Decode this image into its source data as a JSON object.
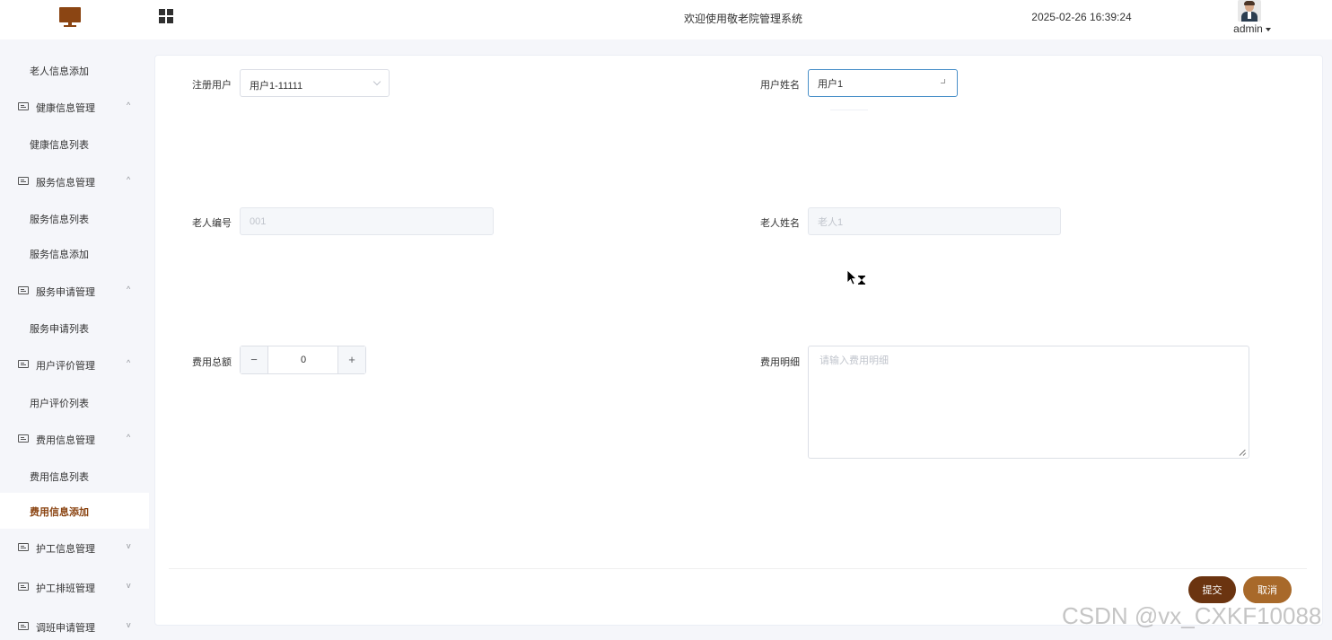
{
  "header": {
    "welcome": "欢迎使用敬老院管理系统",
    "datetime": "2025-02-26 16:39:24",
    "user": "admin"
  },
  "sidebar": {
    "items": [
      {
        "label": "老人信息添加",
        "type": "sub"
      },
      {
        "label": "健康信息管理",
        "type": "group",
        "chevron": "^"
      },
      {
        "label": "健康信息列表",
        "type": "sub"
      },
      {
        "label": "服务信息管理",
        "type": "group",
        "chevron": "^"
      },
      {
        "label": "服务信息列表",
        "type": "sub"
      },
      {
        "label": "服务信息添加",
        "type": "sub"
      },
      {
        "label": "服务申请管理",
        "type": "group",
        "chevron": "^"
      },
      {
        "label": "服务申请列表",
        "type": "sub"
      },
      {
        "label": "用户评价管理",
        "type": "group",
        "chevron": "^"
      },
      {
        "label": "用户评价列表",
        "type": "sub"
      },
      {
        "label": "费用信息管理",
        "type": "group",
        "chevron": "^"
      },
      {
        "label": "费用信息列表",
        "type": "sub"
      },
      {
        "label": "费用信息添加",
        "type": "sub",
        "active": true
      },
      {
        "label": "护工信息管理",
        "type": "group",
        "chevron": "v"
      },
      {
        "label": "护工排班管理",
        "type": "group",
        "chevron": "v"
      },
      {
        "label": "调班申请管理",
        "type": "group",
        "chevron": "v"
      }
    ]
  },
  "form": {
    "registered_user": {
      "label": "注册用户",
      "value": "用户1-11111"
    },
    "user_name": {
      "label": "用户姓名",
      "value": "用户1"
    },
    "elder_id": {
      "label": "老人编号",
      "value": "001"
    },
    "elder_name": {
      "label": "老人姓名",
      "value": "老人1"
    },
    "fee_total": {
      "label": "费用总额",
      "value": "0",
      "minus": "−",
      "plus": "+"
    },
    "fee_detail": {
      "label": "费用明细",
      "placeholder": "请输入费用明细"
    }
  },
  "actions": {
    "submit": "提交",
    "cancel": "取消"
  },
  "watermark": "CSDN @vx_CXKF10088",
  "colors": {
    "brand": "#8b4513",
    "submit": "#6b3410",
    "cancel": "#a8692a",
    "focus_border": "#4a90c9"
  }
}
